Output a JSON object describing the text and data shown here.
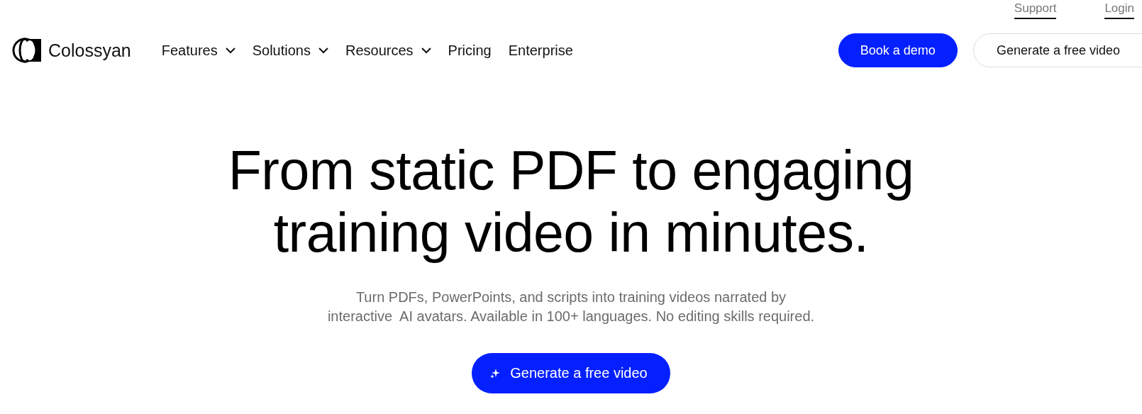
{
  "top_links": [
    {
      "label": "Support"
    },
    {
      "label": "Login"
    }
  ],
  "brand": {
    "name": "Colossyan"
  },
  "nav": [
    {
      "label": "Features",
      "has_menu": true
    },
    {
      "label": "Solutions",
      "has_menu": true
    },
    {
      "label": "Resources",
      "has_menu": true
    },
    {
      "label": "Pricing",
      "has_menu": false
    },
    {
      "label": "Enterprise",
      "has_menu": false
    }
  ],
  "header_buttons": [
    {
      "label": "Book a demo",
      "kind": "primary"
    },
    {
      "label": "Generate a free video",
      "kind": "outline"
    }
  ],
  "hero": {
    "headline_lines": [
      "From static PDF to engaging",
      "training video in minutes."
    ],
    "subtitle_lines": [
      "Turn PDFs, PowerPoints, and scripts into training videos narrated by",
      "interactive  AI avatars. Available in 100+ languages. No editing skills required."
    ],
    "cta": {
      "label": "Generate a free video"
    }
  }
}
